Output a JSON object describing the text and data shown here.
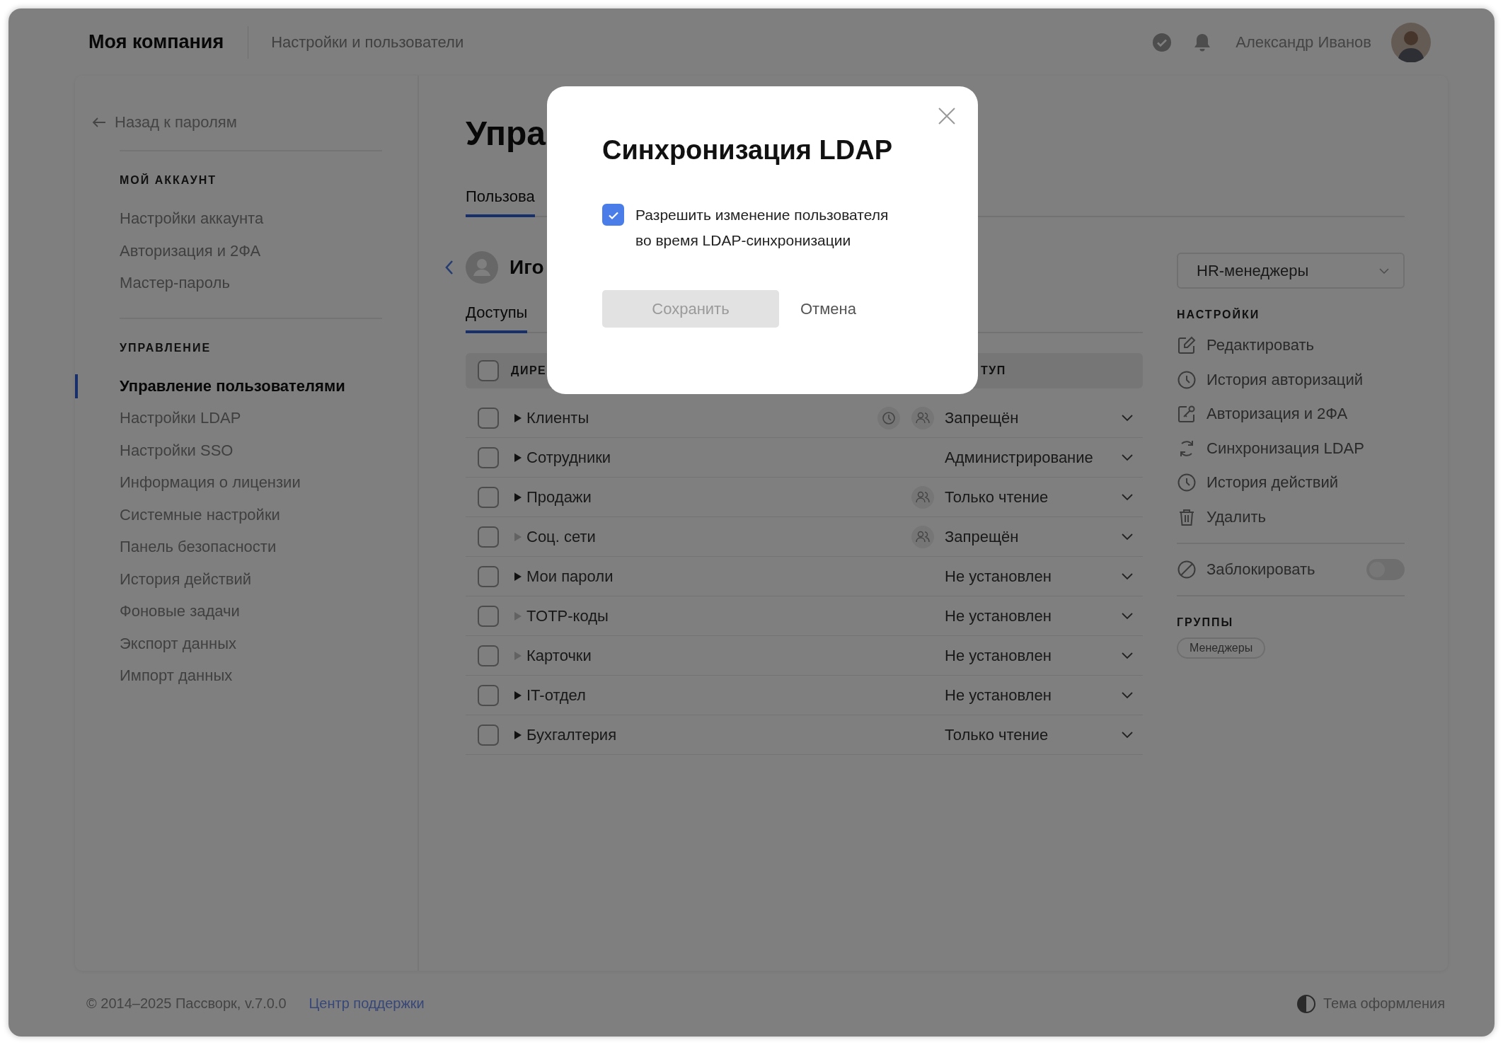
{
  "header": {
    "company": "Моя компания",
    "section": "Настройки и пользователи",
    "user_name": "Александр Иванов"
  },
  "sidebar": {
    "back": "Назад к паролям",
    "groups": [
      {
        "heading": "МОЙ АККАУНТ",
        "items": [
          {
            "label": "Настройки аккаунта",
            "selected": false
          },
          {
            "label": "Авторизация и 2ФА",
            "selected": false
          },
          {
            "label": "Мастер-пароль",
            "selected": false
          }
        ]
      },
      {
        "heading": "УПРАВЛЕНИЕ",
        "items": [
          {
            "label": "Управление пользователями",
            "selected": true
          },
          {
            "label": "Настройки LDAP",
            "selected": false
          },
          {
            "label": "Настройки SSO",
            "selected": false
          },
          {
            "label": "Информация о лицензии",
            "selected": false
          },
          {
            "label": "Системные настройки",
            "selected": false
          },
          {
            "label": "Панель безопасности",
            "selected": false
          },
          {
            "label": "История действий",
            "selected": false
          },
          {
            "label": "Фоновые задачи",
            "selected": false
          },
          {
            "label": "Экспорт данных",
            "selected": false
          },
          {
            "label": "Импорт данных",
            "selected": false
          }
        ]
      }
    ]
  },
  "main": {
    "title": "Упра",
    "tabs": [
      {
        "label": "Пользова",
        "selected": true
      }
    ],
    "user": {
      "name": "Иго"
    },
    "subtabs": [
      {
        "label": "Доступы",
        "selected": true
      }
    ],
    "table": {
      "columns": [
        "ДИРЕ",
        "ТУП"
      ],
      "header_checked": false,
      "rows": [
        {
          "name": "Клиенты",
          "checked": false,
          "has_children": true,
          "scheduled": true,
          "group_access": true,
          "access": "Запрещён"
        },
        {
          "name": "Сотрудники",
          "checked": false,
          "has_children": true,
          "scheduled": false,
          "group_access": false,
          "access": "Администрирование"
        },
        {
          "name": "Продажи",
          "checked": false,
          "has_children": true,
          "scheduled": false,
          "group_access": true,
          "access": "Только чтение"
        },
        {
          "name": "Соц. сети",
          "checked": false,
          "has_children": false,
          "scheduled": false,
          "group_access": true,
          "access": "Запрещён"
        },
        {
          "name": "Мои пароли",
          "checked": false,
          "has_children": true,
          "scheduled": false,
          "group_access": false,
          "access": "Не установлен"
        },
        {
          "name": "TOTP-коды",
          "checked": false,
          "has_children": false,
          "scheduled": false,
          "group_access": false,
          "access": "Не установлен"
        },
        {
          "name": "Карточки",
          "checked": false,
          "has_children": false,
          "scheduled": false,
          "group_access": false,
          "access": "Не установлен"
        },
        {
          "name": "IT-отдел",
          "checked": false,
          "has_children": true,
          "scheduled": false,
          "group_access": false,
          "access": "Не установлен"
        },
        {
          "name": "Бухгалтерия",
          "checked": false,
          "has_children": true,
          "scheduled": false,
          "group_access": false,
          "access": "Только чтение"
        }
      ]
    }
  },
  "right_panel": {
    "group_select": "HR-менеджеры",
    "settings_heading": "НАСТРОЙКИ",
    "actions": [
      "Редактировать",
      "История авторизаций",
      "Авторизация и 2ФА",
      "Синхронизация LDAP",
      "История действий",
      "Удалить"
    ],
    "block": {
      "label": "Заблокировать",
      "on": false
    },
    "groups_heading": "ГРУППЫ",
    "groups": [
      "Менеджеры"
    ]
  },
  "footer": {
    "copyright": "© 2014–2025 Пассворк, v.7.0.0",
    "support_link": "Центр поддержки",
    "theme": "Тема оформления"
  },
  "modal": {
    "title": "Синхронизация LDAP",
    "option": {
      "label": "Разрешить изменение пользователя во время LDAP-синхронизации",
      "checked": true
    },
    "buttons": [
      {
        "label": "Сохранить",
        "kind": "primary",
        "disabled": true
      },
      {
        "label": "Отмена",
        "kind": "link",
        "disabled": false
      }
    ]
  }
}
